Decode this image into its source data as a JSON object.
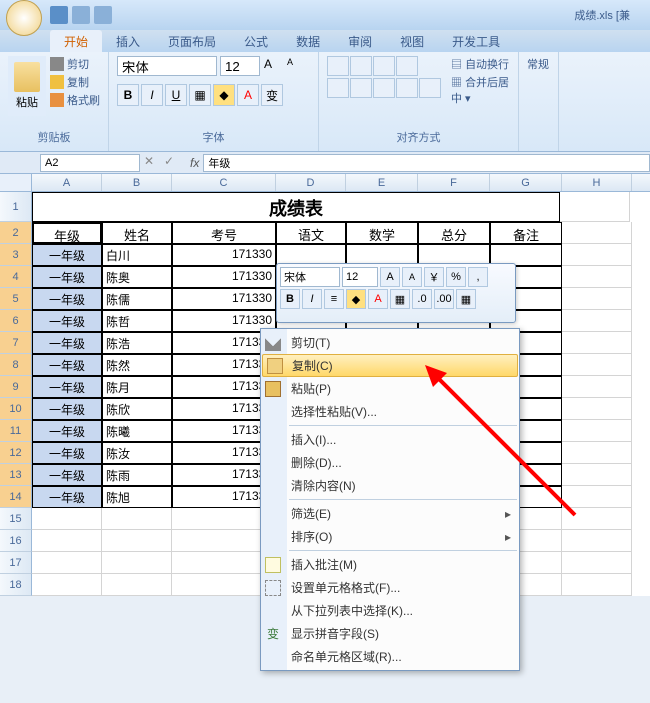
{
  "app": {
    "file_title": "成绩.xls [兼"
  },
  "tabs": {
    "home": "开始",
    "insert": "插入",
    "layout": "页面布局",
    "formula": "公式",
    "data": "数据",
    "review": "审阅",
    "view": "视图",
    "dev": "开发工具"
  },
  "ribbon": {
    "clipboard": {
      "paste": "粘贴",
      "cut": "剪切",
      "copy": "复制",
      "painter": "格式刷",
      "label": "剪贴板"
    },
    "font": {
      "name": "宋体",
      "size": "12",
      "label": "字体"
    },
    "align": {
      "wrap": "自动换行",
      "merge": "合并后居中",
      "label": "对齐方式"
    },
    "style_label": "常规"
  },
  "formula_bar": {
    "name_box": "A2",
    "fx": "fx",
    "value": "年级"
  },
  "columns": [
    "A",
    "B",
    "C",
    "D",
    "E",
    "F",
    "G",
    "H"
  ],
  "rows_visible": 18,
  "sheet": {
    "title": "成绩表",
    "headers": {
      "grade": "年级",
      "name": "姓名",
      "exam_no": "考号",
      "chinese": "语文",
      "math": "数学",
      "total": "总分",
      "remark": "备注"
    },
    "rows": [
      {
        "grade": "一年级",
        "name": "白川",
        "exam_no": "171330"
      },
      {
        "grade": "一年级",
        "name": "陈奥",
        "exam_no": "171330"
      },
      {
        "grade": "一年级",
        "name": "陈儒",
        "exam_no": "171330"
      },
      {
        "grade": "一年级",
        "name": "陈哲",
        "exam_no": "171330"
      },
      {
        "grade": "一年级",
        "name": "陈浩",
        "exam_no": "171330"
      },
      {
        "grade": "一年级",
        "name": "陈然",
        "exam_no": "171330"
      },
      {
        "grade": "一年级",
        "name": "陈月",
        "exam_no": "171330"
      },
      {
        "grade": "一年级",
        "name": "陈欣",
        "exam_no": "171330"
      },
      {
        "grade": "一年级",
        "name": "陈曦",
        "exam_no": "171330"
      },
      {
        "grade": "一年级",
        "name": "陈汝",
        "exam_no": "171330"
      },
      {
        "grade": "一年级",
        "name": "陈雨",
        "exam_no": "171330"
      },
      {
        "grade": "一年级",
        "name": "陈旭",
        "exam_no": "171330"
      }
    ]
  },
  "mini_toolbar": {
    "font": "宋体",
    "size": "12"
  },
  "context_menu": {
    "cut": "剪切(T)",
    "copy": "复制(C)",
    "paste": "粘贴(P)",
    "paste_special": "选择性粘贴(V)...",
    "insert": "插入(I)...",
    "delete": "删除(D)...",
    "clear": "清除内容(N)",
    "filter": "筛选(E)",
    "sort": "排序(O)",
    "insert_comment": "插入批注(M)",
    "format_cells": "设置单元格格式(F)...",
    "pick_list": "从下拉列表中选择(K)...",
    "show_pinyin": "显示拼音字段(S)",
    "name_range": "命名单元格区域(R)..."
  }
}
